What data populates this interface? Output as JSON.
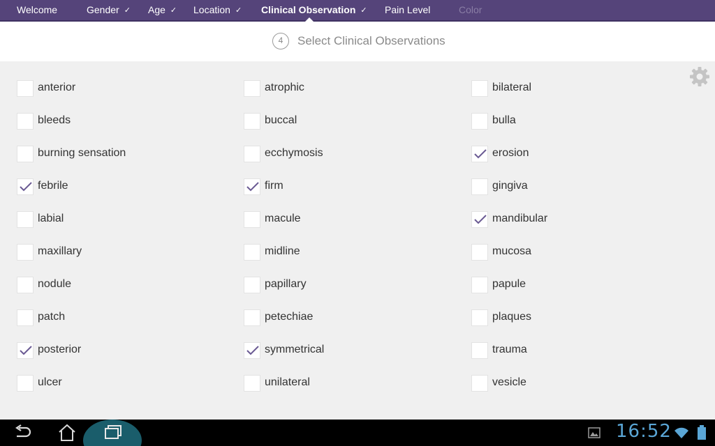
{
  "nav": {
    "items": [
      {
        "label": "Welcome",
        "checked": false,
        "active": false,
        "disabled": false
      },
      {
        "label": "Gender",
        "checked": true,
        "active": false,
        "disabled": false
      },
      {
        "label": "Age",
        "checked": true,
        "active": false,
        "disabled": false
      },
      {
        "label": "Location",
        "checked": true,
        "active": false,
        "disabled": false
      },
      {
        "label": "Clinical Observation",
        "checked": true,
        "active": true,
        "disabled": false
      },
      {
        "label": "Pain Level",
        "checked": false,
        "active": false,
        "disabled": false
      },
      {
        "label": "Color",
        "checked": false,
        "active": false,
        "disabled": true
      }
    ]
  },
  "step": {
    "number": "4",
    "title": "Select Clinical Observations"
  },
  "settings": {
    "icon": "gear-icon"
  },
  "observations": [
    {
      "label": "anterior",
      "checked": false
    },
    {
      "label": "atrophic",
      "checked": false
    },
    {
      "label": "bilateral",
      "checked": false
    },
    {
      "label": "bleeds",
      "checked": false
    },
    {
      "label": "buccal",
      "checked": false
    },
    {
      "label": "bulla",
      "checked": false
    },
    {
      "label": "burning sensation",
      "checked": false
    },
    {
      "label": "ecchymosis",
      "checked": false
    },
    {
      "label": "erosion",
      "checked": true
    },
    {
      "label": "febrile",
      "checked": true
    },
    {
      "label": "firm",
      "checked": true
    },
    {
      "label": "gingiva",
      "checked": false
    },
    {
      "label": "labial",
      "checked": false
    },
    {
      "label": "macule",
      "checked": false
    },
    {
      "label": "mandibular",
      "checked": true
    },
    {
      "label": "maxillary",
      "checked": false
    },
    {
      "label": "midline",
      "checked": false
    },
    {
      "label": "mucosa",
      "checked": false
    },
    {
      "label": "nodule",
      "checked": false
    },
    {
      "label": "papillary",
      "checked": false
    },
    {
      "label": "papule",
      "checked": false
    },
    {
      "label": "patch",
      "checked": false
    },
    {
      "label": "petechiae",
      "checked": false
    },
    {
      "label": "plaques",
      "checked": false
    },
    {
      "label": "posterior",
      "checked": true
    },
    {
      "label": "symmetrical",
      "checked": true
    },
    {
      "label": "trauma",
      "checked": false
    },
    {
      "label": "ulcer",
      "checked": false
    },
    {
      "label": "unilateral",
      "checked": false
    },
    {
      "label": "vesicle",
      "checked": false
    }
  ],
  "system_bar": {
    "time": "16:52",
    "icons": [
      "back-icon",
      "home-icon",
      "recent-apps-icon",
      "gallery-icon",
      "wifi-icon",
      "battery-icon"
    ]
  },
  "colors": {
    "nav_background": "#55447a",
    "check_mark": "#6a5a93",
    "clock": "#5aa6d6"
  }
}
